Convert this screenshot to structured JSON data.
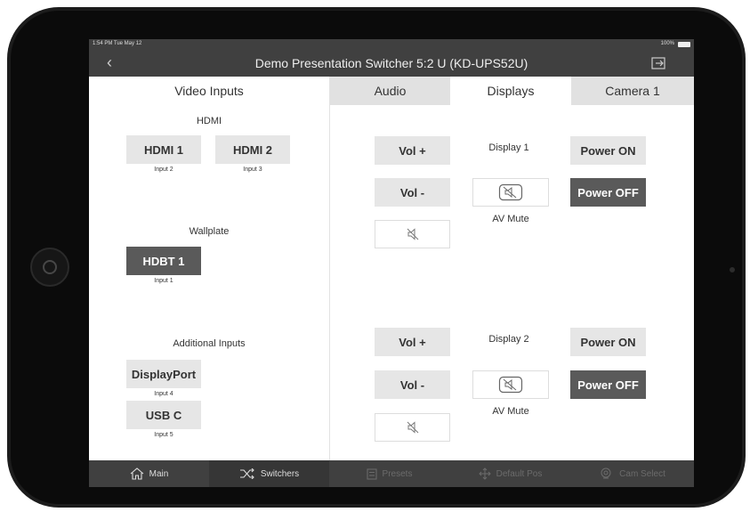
{
  "status": {
    "time": "1:54 PM  Tue May 12",
    "battery": "100%"
  },
  "header": {
    "title": "Demo Presentation Switcher 5:2 U (KD-UPS52U)"
  },
  "left_panel": {
    "title": "Video Inputs",
    "groups": [
      {
        "label": "HDMI",
        "buttons": [
          {
            "label": "HDMI 1",
            "sub": "Input 2"
          },
          {
            "label": "HDMI 2",
            "sub": "Input 3"
          }
        ]
      },
      {
        "label": "Wallplate",
        "buttons": [
          {
            "label": "HDBT 1",
            "sub": "Input 1",
            "selected": true
          }
        ]
      },
      {
        "label": "Additional Inputs",
        "buttons": [
          {
            "label": "DisplayPort",
            "sub": "Input 4"
          },
          {
            "label": "USB C",
            "sub": "Input 5"
          }
        ]
      }
    ]
  },
  "tabs": [
    {
      "label": "Audio"
    },
    {
      "label": "Displays",
      "active": true
    },
    {
      "label": "Camera 1"
    }
  ],
  "displays": [
    {
      "name": "Display 1",
      "vol_up": "Vol +",
      "vol_down": "Vol -",
      "av_mute": "AV Mute",
      "power_on": "Power ON",
      "power_off": "Power OFF"
    },
    {
      "name": "Display 2",
      "vol_up": "Vol +",
      "vol_down": "Vol -",
      "av_mute": "AV Mute",
      "power_on": "Power ON",
      "power_off": "Power OFF"
    }
  ],
  "bottom_nav": [
    {
      "label": "Main",
      "icon": "home-icon"
    },
    {
      "label": "Switchers",
      "icon": "shuffle-icon",
      "active": true
    },
    {
      "label": "Presets",
      "icon": "presets-icon",
      "disabled": true
    },
    {
      "label": "Default Pos",
      "icon": "move-arrows-icon",
      "disabled": true
    },
    {
      "label": "Cam Select",
      "icon": "camera-select-icon",
      "disabled": true
    }
  ],
  "colors": {
    "bar": "#404040",
    "selected": "#5a5a5a",
    "button": "#e6e6e6"
  }
}
